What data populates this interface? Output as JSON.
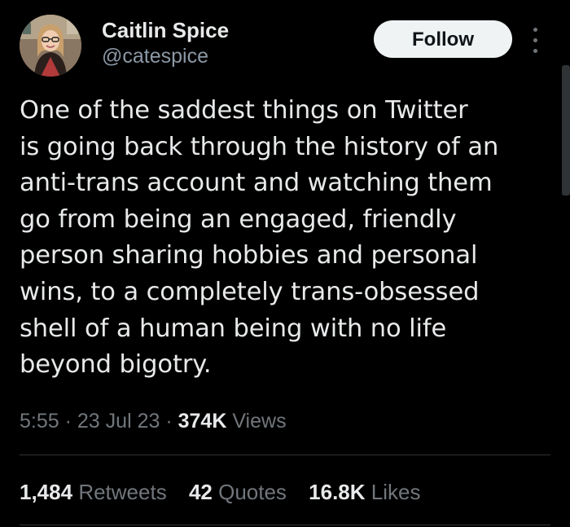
{
  "author": {
    "display_name": "Caitlin Spice",
    "handle": "@catespice"
  },
  "actions": {
    "follow_label": "Follow",
    "more_icon": "more-dots-vertical-icon"
  },
  "tweet": {
    "text": "One of the saddest things on Twitter\nis going back through the history of an\nanti-trans account and watching them\ngo from being an engaged, friendly\nperson sharing hobbies and personal\nwins, to a completely trans-obsessed\nshell of a human being with no life\nbeyond bigotry.",
    "time": "5:55",
    "date": "23 Jul 23",
    "views_count": "374K",
    "views_label": "Views",
    "separator": "·"
  },
  "stats": {
    "retweets_count": "1,484",
    "retweets_label": "Retweets",
    "quotes_count": "42",
    "quotes_label": "Quotes",
    "likes_count": "16.8K",
    "likes_label": "Likes"
  },
  "colors": {
    "background": "#000000",
    "text_primary": "#e7e9ea",
    "text_secondary": "#71767b",
    "follow_button_bg": "#eff3f4",
    "divider": "#2f3336"
  }
}
